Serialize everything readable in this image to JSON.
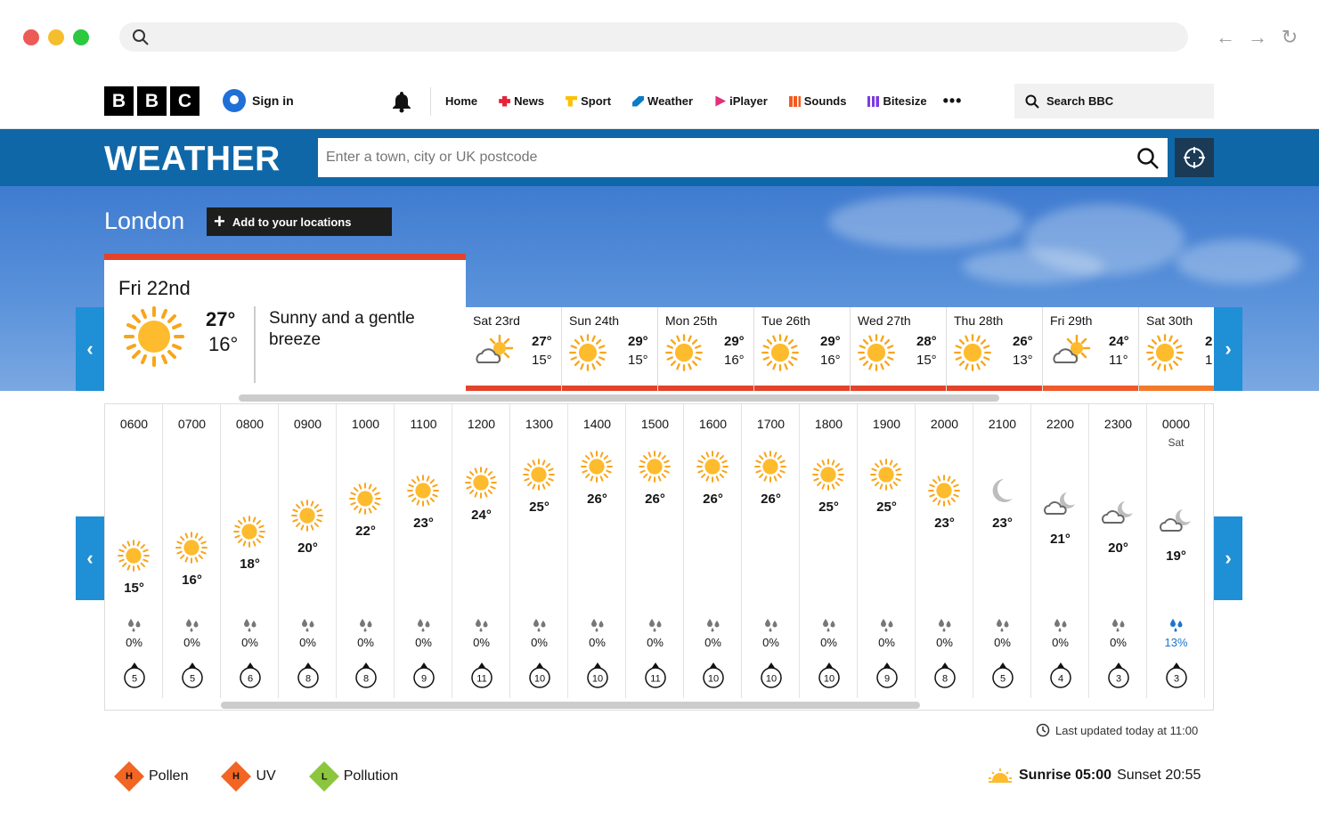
{
  "browser": {
    "url": "",
    "dots": [
      "#ec5b55",
      "#f5be2f",
      "#2cc840"
    ]
  },
  "bbc": {
    "logo": [
      "B",
      "B",
      "C"
    ],
    "signin": "Sign in",
    "nav": [
      {
        "label": "Home",
        "icon": "none"
      },
      {
        "label": "News",
        "icon": "news-icon",
        "color": "#e4243b"
      },
      {
        "label": "Sport",
        "icon": "sport-icon",
        "color": "#fdc000"
      },
      {
        "label": "Weather",
        "icon": "weather-icon",
        "color": "#0a7bc4"
      },
      {
        "label": "iPlayer",
        "icon": "iplayer-icon",
        "color": "#e0317a"
      },
      {
        "label": "Sounds",
        "icon": "sounds-icon",
        "color": "#f25a1e"
      },
      {
        "label": "Bitesize",
        "icon": "bitesize-icon",
        "color": "#7a3ae3"
      }
    ],
    "more": "•••",
    "search_label": "Search BBC"
  },
  "weather": {
    "title": "WEATHER",
    "search_placeholder": "Enter a town, city or UK postcode",
    "location": "London",
    "add_location": "Add to your locations"
  },
  "today": {
    "day": "Fri 22nd",
    "high": "27°",
    "low": "16°",
    "description": "Sunny and a gentle breeze"
  },
  "days": [
    {
      "day": "Sat 23rd",
      "high": "27°",
      "low": "15°",
      "icon": "sun-cloud-icon",
      "bar": "#e4432b"
    },
    {
      "day": "Sun 24th",
      "high": "29°",
      "low": "15°",
      "icon": "sun-icon",
      "bar": "#e4432b"
    },
    {
      "day": "Mon 25th",
      "high": "29°",
      "low": "16°",
      "icon": "sun-icon",
      "bar": "#e4432b"
    },
    {
      "day": "Tue 26th",
      "high": "29°",
      "low": "16°",
      "icon": "sun-icon",
      "bar": "#e4432b"
    },
    {
      "day": "Wed 27th",
      "high": "28°",
      "low": "15°",
      "icon": "sun-icon",
      "bar": "#e4432b"
    },
    {
      "day": "Thu 28th",
      "high": "26°",
      "low": "13°",
      "icon": "sun-icon",
      "bar": "#e4432b"
    },
    {
      "day": "Fri 29th",
      "high": "24°",
      "low": "11°",
      "icon": "sun-cloud-icon",
      "bar": "#ee5a2c"
    },
    {
      "day": "Sat 30th",
      "high": "2",
      "low": "1",
      "icon": "sun-icon",
      "bar": "#f27a2c"
    }
  ],
  "hourly": [
    {
      "time": "0600",
      "temp": "15°",
      "icon": "sun-icon",
      "rain": "0%",
      "wind": "5"
    },
    {
      "time": "0700",
      "temp": "16°",
      "icon": "sun-icon",
      "rain": "0%",
      "wind": "5"
    },
    {
      "time": "0800",
      "temp": "18°",
      "icon": "sun-icon",
      "rain": "0%",
      "wind": "6"
    },
    {
      "time": "0900",
      "temp": "20°",
      "icon": "sun-icon",
      "rain": "0%",
      "wind": "8"
    },
    {
      "time": "1000",
      "temp": "22°",
      "icon": "sun-icon",
      "rain": "0%",
      "wind": "8"
    },
    {
      "time": "1100",
      "temp": "23°",
      "icon": "sun-icon",
      "rain": "0%",
      "wind": "9"
    },
    {
      "time": "1200",
      "temp": "24°",
      "icon": "sun-icon",
      "rain": "0%",
      "wind": "11"
    },
    {
      "time": "1300",
      "temp": "25°",
      "icon": "sun-icon",
      "rain": "0%",
      "wind": "10"
    },
    {
      "time": "1400",
      "temp": "26°",
      "icon": "sun-icon",
      "rain": "0%",
      "wind": "10"
    },
    {
      "time": "1500",
      "temp": "26°",
      "icon": "sun-icon",
      "rain": "0%",
      "wind": "11"
    },
    {
      "time": "1600",
      "temp": "26°",
      "icon": "sun-icon",
      "rain": "0%",
      "wind": "10"
    },
    {
      "time": "1700",
      "temp": "26°",
      "icon": "sun-icon",
      "rain": "0%",
      "wind": "10"
    },
    {
      "time": "1800",
      "temp": "25°",
      "icon": "sun-icon",
      "rain": "0%",
      "wind": "10"
    },
    {
      "time": "1900",
      "temp": "25°",
      "icon": "sun-icon",
      "rain": "0%",
      "wind": "9"
    },
    {
      "time": "2000",
      "temp": "23°",
      "icon": "sun-icon",
      "rain": "0%",
      "wind": "8"
    },
    {
      "time": "2100",
      "temp": "23°",
      "icon": "moon-icon",
      "rain": "0%",
      "wind": "5"
    },
    {
      "time": "2200",
      "temp": "21°",
      "icon": "moon-cloud-icon",
      "rain": "0%",
      "wind": "4"
    },
    {
      "time": "2300",
      "temp": "20°",
      "icon": "moon-cloud-icon",
      "rain": "0%",
      "wind": "3"
    },
    {
      "time": "0000",
      "sub": "Sat",
      "temp": "19°",
      "icon": "moon-cloud-icon",
      "rain": "13%",
      "wind": "3"
    }
  ],
  "updated": "Last updated today at 11:00",
  "indices": [
    {
      "letter": "H",
      "label": "Pollen",
      "color": "#f26522"
    },
    {
      "letter": "H",
      "label": "UV",
      "color": "#f26522"
    },
    {
      "letter": "L",
      "label": "Pollution",
      "color": "#8cc63f"
    }
  ],
  "sunrise_label": "Sunrise 05:00",
  "sunset_label": "Sunset 20:55"
}
